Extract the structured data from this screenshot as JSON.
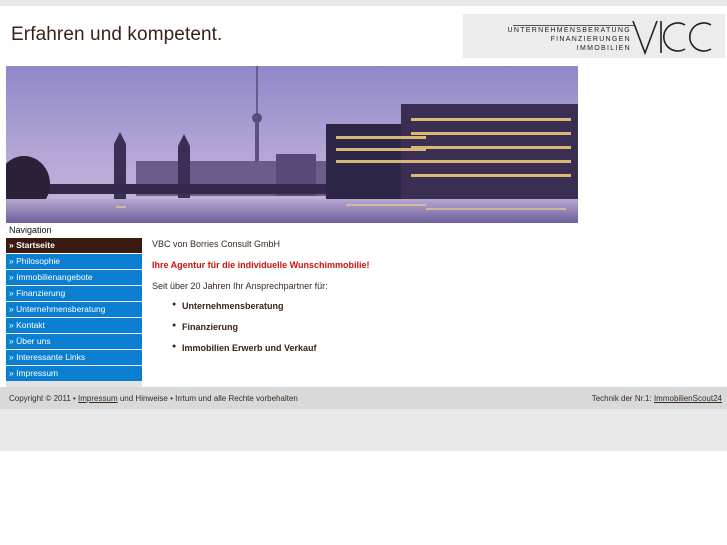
{
  "header": {
    "slogan": "Erfahren und kompetent.",
    "logo": {
      "line1": "UNTERNEHMENSBERATUNG",
      "line2": "FINANZIERUNGEN",
      "line3": "IMMOBILIEN",
      "mark": "VBC"
    }
  },
  "nav": {
    "title": "Navigation",
    "items": [
      {
        "label": "» Startseite",
        "active": true
      },
      {
        "label": "» Philosophie"
      },
      {
        "label": "» Immobilienangebote"
      },
      {
        "label": "» Finanzierung"
      },
      {
        "label": "» Unternehmensberatung"
      },
      {
        "label": "» Kontakt"
      },
      {
        "label": "» Über uns"
      },
      {
        "label": "» Interessante Links"
      },
      {
        "label": "» Impressum"
      }
    ]
  },
  "content": {
    "company": "VBC von Borries Consult GmbH",
    "headline": "Ihre Agentur für die individuelle Wunschimmobilie!",
    "intro": "Seit über 20 Jahren Ihr Ansprechpartner für:",
    "services": [
      "Unternehmensberatung",
      "Finanzierung",
      "Immobilien Erwerb und Verkauf"
    ]
  },
  "footer": {
    "copyright_prefix": "Copyright © 2011 •",
    "impressum_link": "Impressum",
    "copyright_suffix": "und Hinweise • Irrtum und alle Rechte vorbehalten",
    "tech_prefix": "Technik der Nr.1:",
    "tech_link": "ImmobilienScout24"
  },
  "colors": {
    "nav_blue": "#0a7fd1",
    "nav_active": "#3a1a10",
    "headline_red": "#cc1111",
    "footer_bg": "#d9d9d9"
  }
}
